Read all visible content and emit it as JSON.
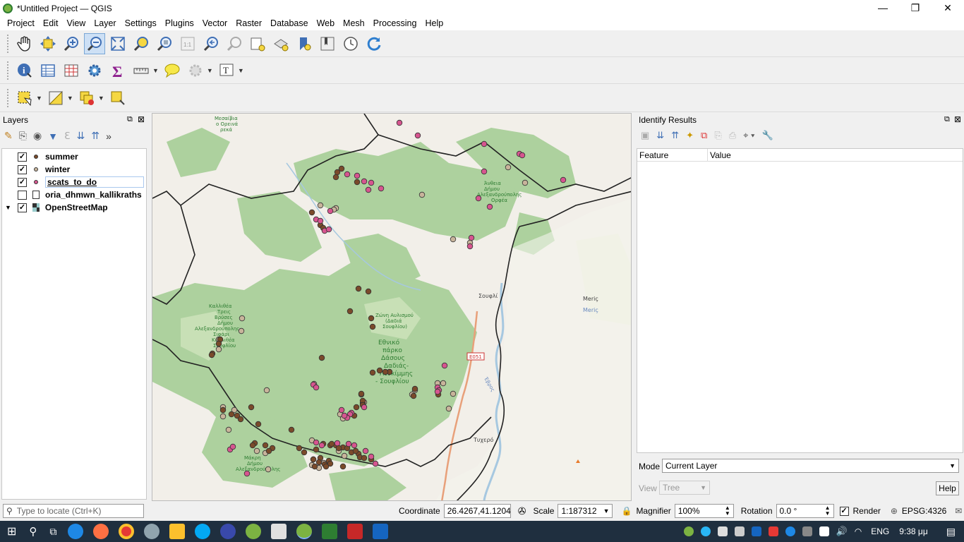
{
  "window": {
    "title": "*Untitled Project — QGIS",
    "controls": [
      "—",
      "❐",
      "✕"
    ]
  },
  "menu": [
    "Project",
    "Edit",
    "View",
    "Layer",
    "Settings",
    "Plugins",
    "Vector",
    "Raster",
    "Database",
    "Web",
    "Mesh",
    "Processing",
    "Help"
  ],
  "layers_panel": {
    "title": "Layers",
    "layers": [
      {
        "name": "summer",
        "checked": true,
        "color": "#7a4a2a"
      },
      {
        "name": "winter",
        "checked": true,
        "color": "#c8b49b"
      },
      {
        "name": "scats_to_do",
        "checked": true,
        "color": "#d6558f"
      },
      {
        "name": "oria_dhmwn_kallikraths",
        "checked": false,
        "color": ""
      },
      {
        "name": "OpenStreetMap",
        "checked": true,
        "color": ""
      }
    ]
  },
  "map": {
    "labels": {
      "top_left": [
        "Μεσαίβια",
        "ο Ορεινά",
        "ρεκά"
      ],
      "dadia_label": [
        "Ζώνη Αυλισμού",
        "(Δαδιά",
        "Σουφλίου)"
      ],
      "park_label": [
        "Εθνικό",
        "πάρκο",
        "Δάσους",
        "Δαδιάς-",
        "Λευκίμμης",
        "- Σουφλίου"
      ],
      "kallithea_label": [
        "Καλλιθέα",
        "Τρεις",
        "Βρύσες",
        "Δήμου",
        "Αλεξανδρούπολης",
        "Σιφάρι",
        "Καλλιθέα",
        "Σουφλίου"
      ],
      "soufli": "Σουφλί",
      "meric": [
        "Meriç",
        "Meriç"
      ],
      "road": "E051",
      "tychero": "Τυχερό",
      "river": "Έβρος",
      "left_bottom": [
        "Μάκρη",
        "Δήμου",
        "Αλεξανδρούπολης"
      ],
      "upper_right": [
        "Άνθεια",
        "Δήμου",
        "Αλεξανδρούπολης",
        "Ορφέα"
      ]
    },
    "colors": {
      "summer": "#7a4a2a",
      "winter": "#c8b49b",
      "scats": "#d6558f",
      "forest": "#add19e",
      "background": "#f2efe9",
      "border": "#222222"
    }
  },
  "identify": {
    "title": "Identify Results",
    "columns": [
      "Feature",
      "Value"
    ],
    "mode_label": "Mode",
    "mode_value": "Current Layer",
    "view_label": "View",
    "view_value": "Tree",
    "help": "Help"
  },
  "status": {
    "locate_placeholder": "Type to locate (Ctrl+K)",
    "coordinate_label": "Coordinate",
    "coordinate_value": "26.4267,41.1204",
    "scale_label": "Scale",
    "scale_value": "1:187312",
    "magnifier_label": "Magnifier",
    "magnifier_value": "100%",
    "rotation_label": "Rotation",
    "rotation_value": "0.0 °",
    "render_label": "Render",
    "crs": "EPSG:4326"
  },
  "taskbar": {
    "lang": "ENG",
    "time": "9:38 μμ"
  }
}
